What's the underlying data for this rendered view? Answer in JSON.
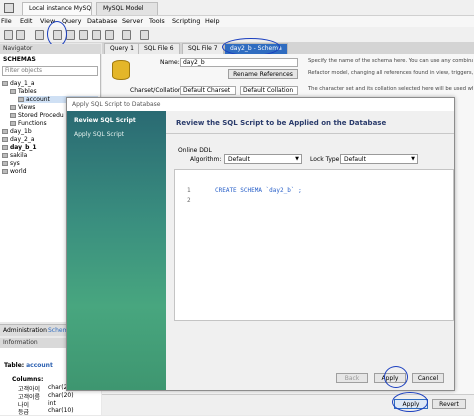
{
  "window_tabs": {
    "home_icon": "home-icon",
    "tab1": "Local instance MySQL",
    "tab2": "MySQL Model"
  },
  "menu": [
    "File",
    "Edit",
    "View",
    "Query",
    "Database",
    "Server",
    "Tools",
    "Scripting",
    "Help"
  ],
  "navigator": {
    "header": "Navigator",
    "schemas_label": "SCHEMAS",
    "filter_placeholder": "Filter objects",
    "tree": [
      "day_1_a",
      "Tables",
      "account",
      "Views",
      "Stored Procedu",
      "Functions",
      "day_1b",
      "day_2_a",
      "day_b_1",
      "sakila",
      "sys",
      "world"
    ]
  },
  "admin_tabs": {
    "administration": "Administration",
    "schemas": "Schema"
  },
  "information": {
    "header": "Information",
    "table_label": "Table:",
    "table_name": "account",
    "columns_label": "Columns:",
    "columns": [
      {
        "name": "고객아이",
        "type": "char(20"
      },
      {
        "name": "고객이름",
        "type": "char(20)"
      },
      {
        "name": "나이",
        "type": "int"
      },
      {
        "name": "등급",
        "type": "char(10)"
      }
    ]
  },
  "query_tabs": [
    "Query 1",
    "SQL File 6",
    "SQL File 7",
    "day2_b - Schema"
  ],
  "schema_editor": {
    "name_label": "Name:",
    "name_value": "day2_b",
    "rename_button": "Rename References",
    "charset_label": "Charset/Collation:",
    "charset_value": "Default Charset",
    "collation_value": "Default Collation",
    "desc1": "Specify the name of the schema here. You can use any combination of",
    "desc2": "Refactor model, changing all references found in view, triggers, stored proced",
    "desc3": "The character set and its collation selected here will be used when no ot"
  },
  "dialog": {
    "title": "Apply SQL Script to Database",
    "steps": [
      "Review SQL Script",
      "Apply SQL Script"
    ],
    "heading": "Review the SQL Script to be Applied on the Database",
    "ddl_label": "Online DDL",
    "algorithm_label": "Algorithm:",
    "algorithm_value": "Default",
    "lock_label": "Lock Type:",
    "lock_value": "Default",
    "code_lines": [
      {
        "num": "1",
        "text": "CREATE SCHEMA `day2_b` ;"
      },
      {
        "num": "2",
        "text": ""
      }
    ],
    "back_button": "Back",
    "apply_button": "Apply",
    "cancel_button": "Cancel"
  },
  "bottom": {
    "apply_button": "Apply",
    "revert_button": "Revert"
  },
  "colors": {
    "accent": "#2f6cc0",
    "annotation_circle": "#1b3fbf",
    "sidebar_gradient": "#3a8f7f"
  }
}
